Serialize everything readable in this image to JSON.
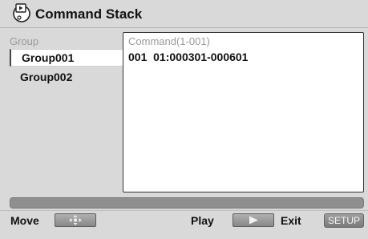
{
  "window": {
    "title": "Command Stack"
  },
  "sidebar": {
    "header": "Group",
    "items": [
      {
        "label": "Group001",
        "selected": true
      },
      {
        "label": "Group002",
        "selected": false
      }
    ]
  },
  "command_panel": {
    "header": "Command(1-001)",
    "rows": [
      {
        "text": "001  01:000301-000601"
      }
    ]
  },
  "footer": {
    "move_label": "Move",
    "move_icon": "move-arrows-icon",
    "play_label": "Play",
    "play_icon": "play-icon",
    "exit_label": "Exit",
    "setup_label": "SETUP"
  },
  "colors": {
    "background": "#d9d9d9",
    "panel": "#ffffff",
    "muted_text": "#9a9a9a",
    "key_gray": "#8f8f8f"
  }
}
